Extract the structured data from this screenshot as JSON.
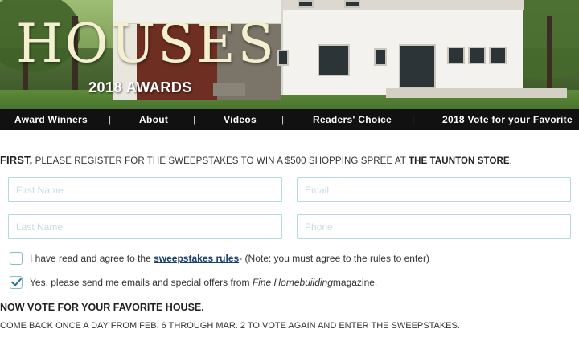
{
  "hero": {
    "title": "HOUSES",
    "subtitle": "2018 AWARDS"
  },
  "nav": {
    "items": [
      {
        "label": "Award Winners"
      },
      {
        "label": "About"
      },
      {
        "label": "Videos"
      },
      {
        "label": "Readers' Choice"
      },
      {
        "label": "2018 Vote for your Favorite"
      }
    ],
    "separator": "|"
  },
  "intro": {
    "lead": "FIRST,",
    "text": " PLEASE REGISTER FOR THE SWEEPSTAKES TO WIN A $500 SHOPPING SPREE AT ",
    "store": "THE TAUNTON STORE",
    "end": "."
  },
  "form": {
    "first_name": {
      "placeholder": "First Name",
      "value": ""
    },
    "email": {
      "placeholder": "Email",
      "value": ""
    },
    "last_name": {
      "placeholder": "Last Name",
      "value": ""
    },
    "phone": {
      "placeholder": "Phone",
      "value": ""
    },
    "rules_checkbox": {
      "checked": false,
      "before": "I have read and agree to the ",
      "link": "sweepstakes rules",
      "after": " - (Note: you must agree to the rules to enter)"
    },
    "emails_checkbox": {
      "checked": true,
      "before": "Yes, please send me emails and special offers from ",
      "italic": "Fine Homebuilding",
      "after": " magazine."
    }
  },
  "vote": {
    "heading": "NOW VOTE FOR YOUR FAVORITE HOUSE.",
    "note": "COME BACK ONCE A DAY FROM FEB. 6 THROUGH MAR. 2 TO VOTE AGAIN AND ENTER THE SWEEPSTAKES."
  },
  "colors": {
    "nav_bg": "#111111",
    "field_border": "#b7d8df",
    "link": "#1c3f6e",
    "check": "#1a6fa8"
  }
}
